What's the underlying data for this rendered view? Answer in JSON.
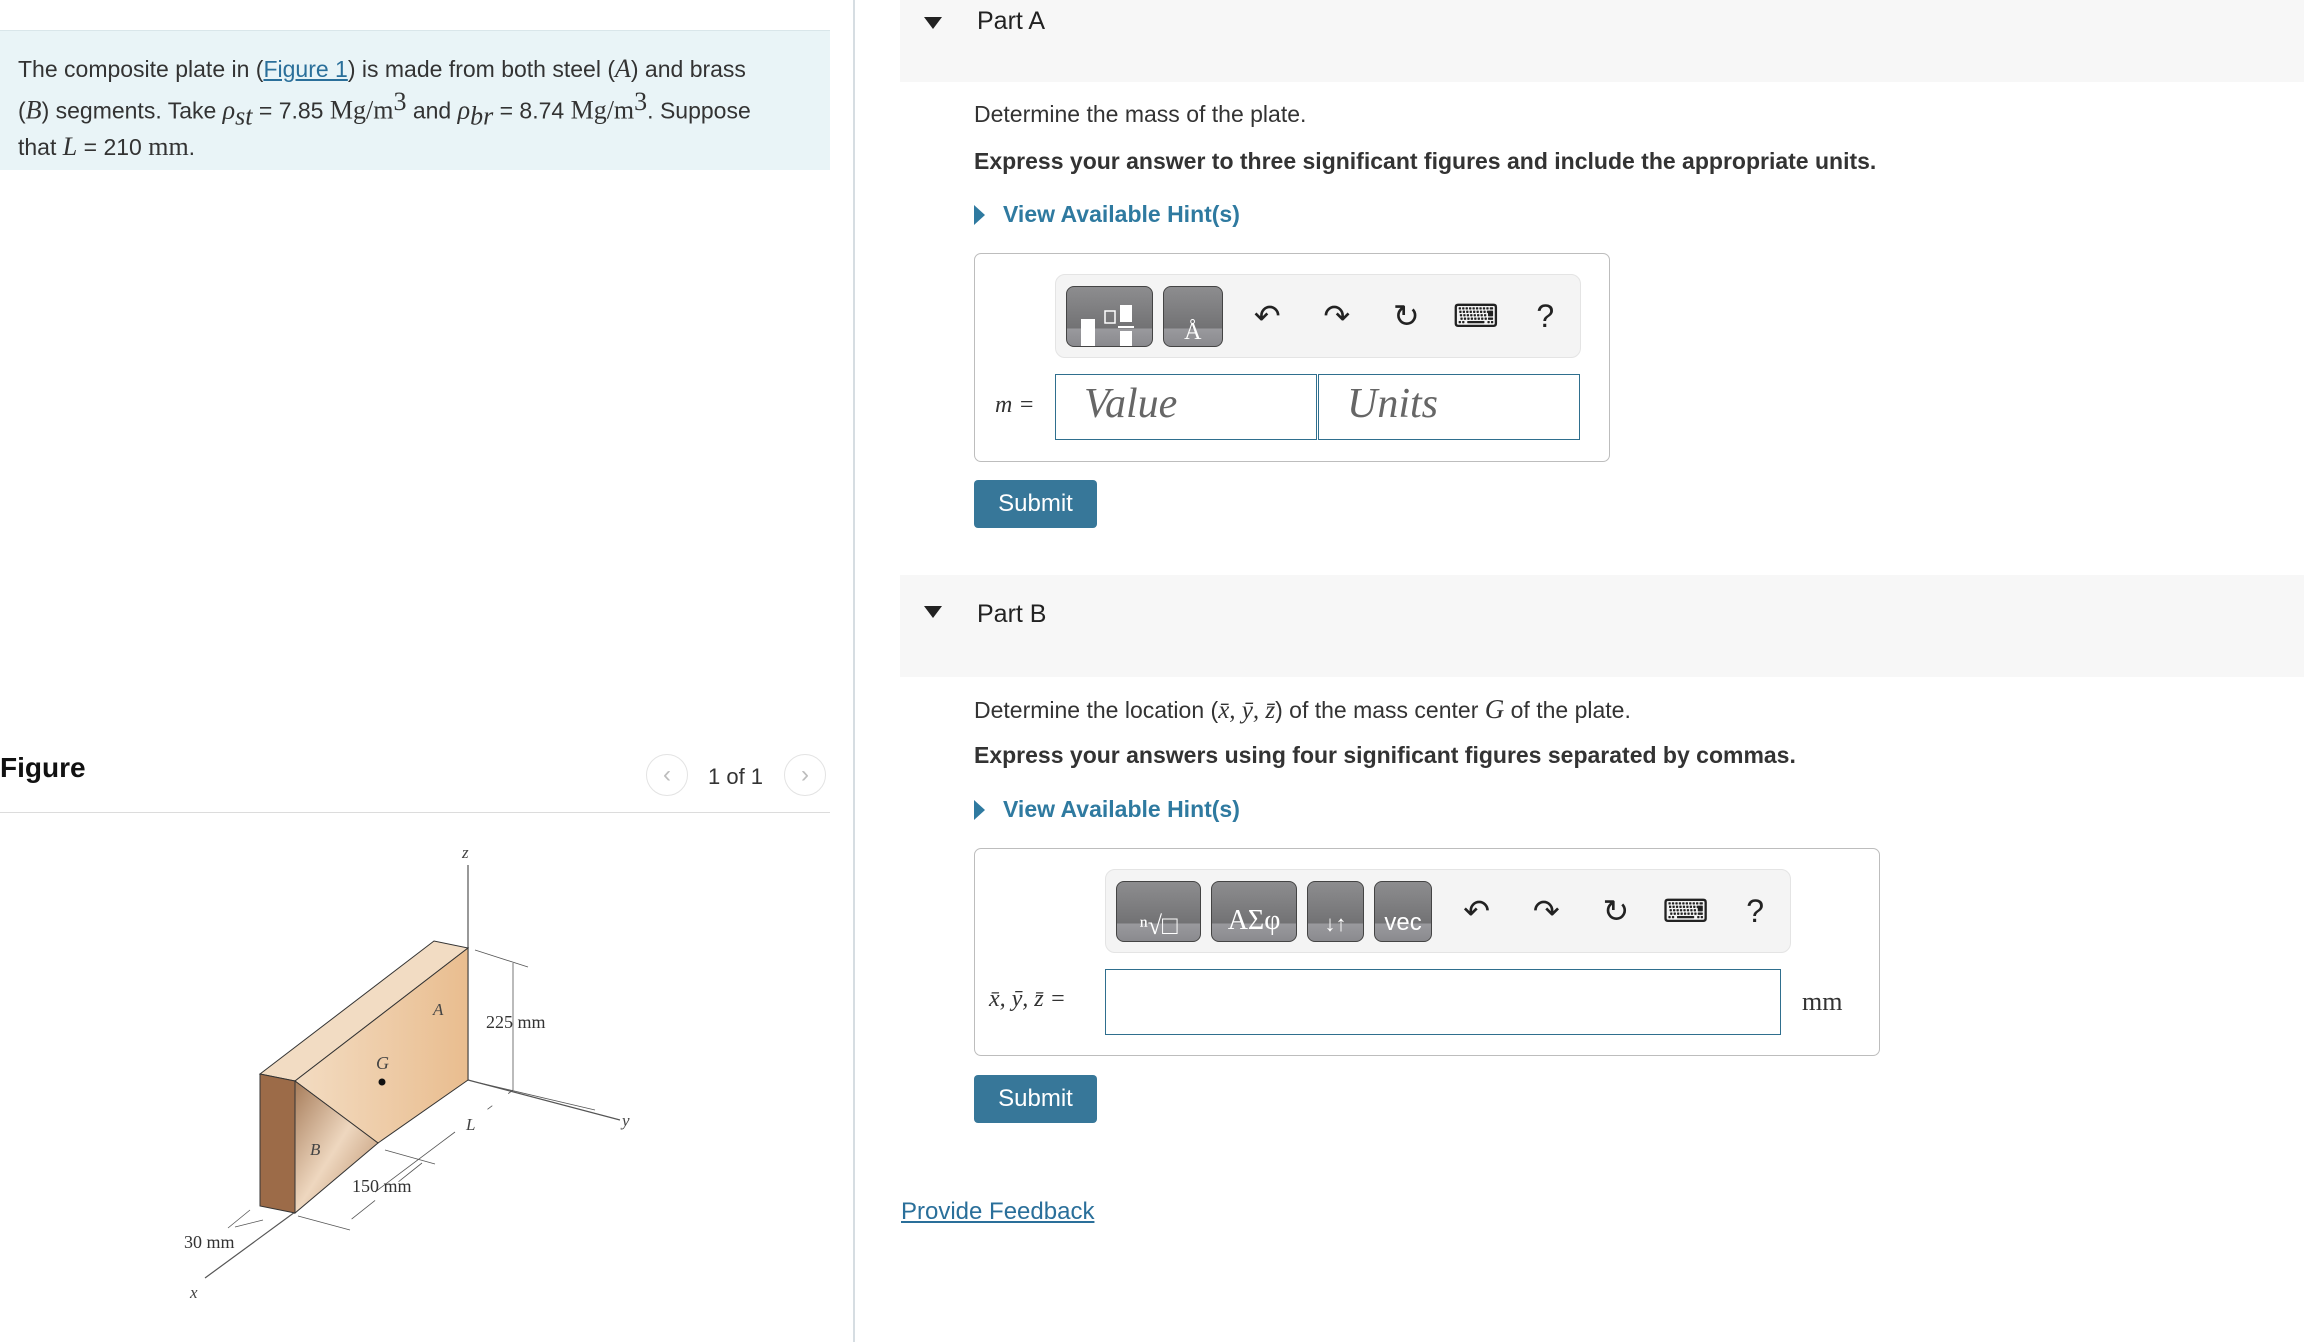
{
  "problem": {
    "text_1": "The composite plate in (",
    "figure_link": "Figure 1",
    "text_2": ") is made from both steel (",
    "A": "A",
    "text_3": ") and brass",
    "B": "B",
    "text_4": ") segments. Take ",
    "rho": "ρ",
    "st": "st",
    "rho_st_value": " = 7.85 ",
    "unit_mg": "Mg/m",
    "cube": "3",
    "and": " and ",
    "br": "br",
    "rho_br_value": " = 8.74 ",
    "suppose": ". Suppose",
    "that": "that ",
    "L": "L",
    "L_value": " = 210 ",
    "mm": "mm",
    "period": "."
  },
  "figure": {
    "title": "Figure",
    "pagination": "1 of 1",
    "prev_icon": "chevron-left",
    "next_icon": "chevron-right",
    "labels": {
      "z": "z",
      "y": "y",
      "x": "x",
      "A": "A",
      "B": "B",
      "G": "G",
      "L": "L",
      "height": "225 mm",
      "segB": "150 mm",
      "thickness": "30 mm"
    }
  },
  "partA": {
    "title": "Part A",
    "question": "Determine the mass of the plate.",
    "instruction": "Express your answer to three significant figures and include the appropriate units.",
    "hint": "View Available Hint(s)",
    "toolbar": {
      "buttons": [
        "templates",
        "units"
      ],
      "units_glyph": "Å",
      "undo": "↶",
      "redo": "↷",
      "reset": "↻",
      "keyboard": "⌨",
      "help": "?"
    },
    "variable": "m =",
    "value_placeholder": "Value",
    "units_placeholder": "Units",
    "submit": "Submit"
  },
  "partB": {
    "title": "Part B",
    "question_1": "Determine the location (",
    "question_vars": "x̄, ȳ, z̄",
    "question_2": ") of the mass center ",
    "question_G": "G",
    "question_3": " of the plate.",
    "instruction": "Express your answers using four significant figures separated by commas.",
    "hint": "View Available Hint(s)",
    "toolbar": {
      "buttons": [
        "templates",
        "greek",
        "arrows",
        "vector"
      ],
      "templates_glyph": "ⁿ√□",
      "greek_glyph": "ΑΣφ",
      "arrows_glyph": "↓↑",
      "vector_glyph": "vec",
      "undo": "↶",
      "redo": "↷",
      "reset": "↻",
      "keyboard": "⌨",
      "help": "?"
    },
    "variable": "x̄, ȳ, z̄ =",
    "answer_value": "",
    "unit": "mm",
    "submit": "Submit"
  },
  "feedback": "Provide Feedback"
}
